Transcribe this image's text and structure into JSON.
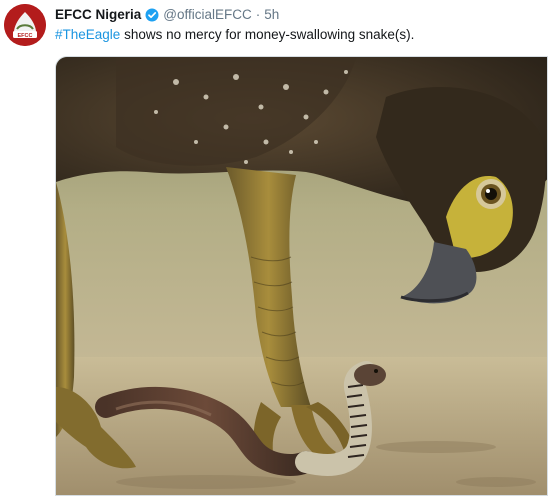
{
  "tweet": {
    "display_name": "EFCC Nigeria",
    "handle": "@officialEFCC",
    "separator": "·",
    "time": "5h",
    "hashtag": "#TheEagle",
    "text": " shows no mercy for money-swallowing snake(s).",
    "avatar_text": "EFCC",
    "verified_icon": "verified-badge-icon",
    "colors": {
      "hashtag": "#1b95e0",
      "verified": "#1da1f2",
      "name": "#14171a",
      "meta": "#657786"
    }
  },
  "media": {
    "type": "photo"
  }
}
